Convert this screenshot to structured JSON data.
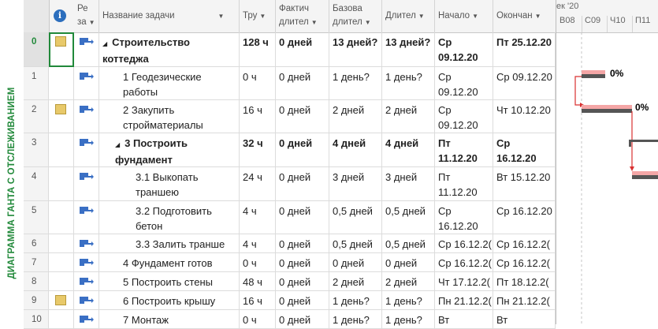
{
  "side_label": "ДИАГРАММА ГАНТА С ОТСЛЕЖИВАНИЕМ",
  "headers": {
    "mode_1": "Ре",
    "mode_2": "за",
    "name": "Название задачи",
    "work": "Тру",
    "actual_1": "Фактич",
    "actual_2": "длител",
    "baseline_1": "Базова",
    "baseline_2": "длител",
    "duration": "Длител",
    "start": "Начало",
    "finish": "Окончан"
  },
  "gantt": {
    "week": "ек '20",
    "days": [
      "В08",
      "С09",
      "Ч10",
      "П11"
    ],
    "labels": [
      "0%",
      "0%"
    ]
  },
  "rows": [
    {
      "id": "0",
      "note": true,
      "bold": true,
      "indent": 0,
      "collapse": "◢",
      "name": "Строительство коттеджа",
      "work": "128 ч",
      "actual": "0 дней",
      "baseline": "13 дней?",
      "duration": "13 дней?",
      "start": "Ср 09.12.20",
      "finish": "Пт 25.12.20",
      "h": 44
    },
    {
      "id": "1",
      "note": false,
      "bold": false,
      "indent": 1,
      "collapse": "",
      "name": "1 Геодезические работы",
      "work": "0 ч",
      "actual": "0 дней",
      "baseline": "1 день?",
      "duration": "1 день?",
      "start": "Ср 09.12.20",
      "finish": "Ср 09.12.20",
      "h": 42
    },
    {
      "id": "2",
      "note": true,
      "bold": false,
      "indent": 1,
      "collapse": "",
      "name": "2 Закупить стройматериалы",
      "work": "16 ч",
      "actual": "0 дней",
      "baseline": "2 дней",
      "duration": "2 дней",
      "start": "Ср 09.12.20",
      "finish": "Чт 10.12.20",
      "h": 42
    },
    {
      "id": "3",
      "note": false,
      "bold": true,
      "indent": 1,
      "collapse": "◢",
      "name": "3 Построить фундамент",
      "work": "32 ч",
      "actual": "0 дней",
      "baseline": "4 дней",
      "duration": "4 дней",
      "start": "Пт 11.12.20",
      "finish": "Ср 16.12.20",
      "h": 43
    },
    {
      "id": "4",
      "note": false,
      "bold": false,
      "indent": 2,
      "collapse": "",
      "name": "3.1 Выкопать траншею",
      "work": "24 ч",
      "actual": "0 дней",
      "baseline": "3 дней",
      "duration": "3 дней",
      "start": "Пт 11.12.20",
      "finish": "Вт 15.12.20",
      "h": 43
    },
    {
      "id": "5",
      "note": false,
      "bold": false,
      "indent": 2,
      "collapse": "",
      "name": "3.2 Подготовить бетон",
      "work": "4 ч",
      "actual": "0 дней",
      "baseline": "0,5 дней",
      "duration": "0,5 дней",
      "start": "Ср 16.12.20",
      "finish": "Ср 16.12.20",
      "h": 42
    },
    {
      "id": "6",
      "note": false,
      "bold": false,
      "indent": 2,
      "collapse": "",
      "name": "3.3 Залить транше",
      "work": "4 ч",
      "actual": "0 дней",
      "baseline": "0,5 дней",
      "duration": "0,5 дней",
      "start": "Ср 16.12.2(",
      "finish": "Ср 16.12.2(",
      "h": 24
    },
    {
      "id": "7",
      "note": false,
      "bold": false,
      "indent": 1,
      "collapse": "",
      "name": "4 Фундамент готов",
      "work": "0 ч",
      "actual": "0 дней",
      "baseline": "0 дней",
      "duration": "0 дней",
      "start": "Ср 16.12.2(",
      "finish": "Ср 16.12.2(",
      "h": 24
    },
    {
      "id": "8",
      "note": false,
      "bold": false,
      "indent": 1,
      "collapse": "",
      "name": "5 Построить стены",
      "work": "48 ч",
      "actual": "0 дней",
      "baseline": "2 дней",
      "duration": "2 дней",
      "start": "Чт 17.12.2(",
      "finish": "Пт 18.12.2(",
      "h": 24
    },
    {
      "id": "9",
      "note": true,
      "bold": false,
      "indent": 1,
      "collapse": "",
      "name": "6 Построить крышу",
      "work": "16 ч",
      "actual": "0 дней",
      "baseline": "1 день?",
      "duration": "1 день?",
      "start": "Пн 21.12.2(",
      "finish": "Пн 21.12.2(",
      "h": 24
    },
    {
      "id": "10",
      "note": false,
      "bold": false,
      "indent": 1,
      "collapse": "",
      "name": "7 Монтаж",
      "work": "0 ч",
      "actual": "0 дней",
      "baseline": "1 день?",
      "duration": "1 день?",
      "start": "Вт",
      "finish": "Вт",
      "h": 24
    }
  ]
}
